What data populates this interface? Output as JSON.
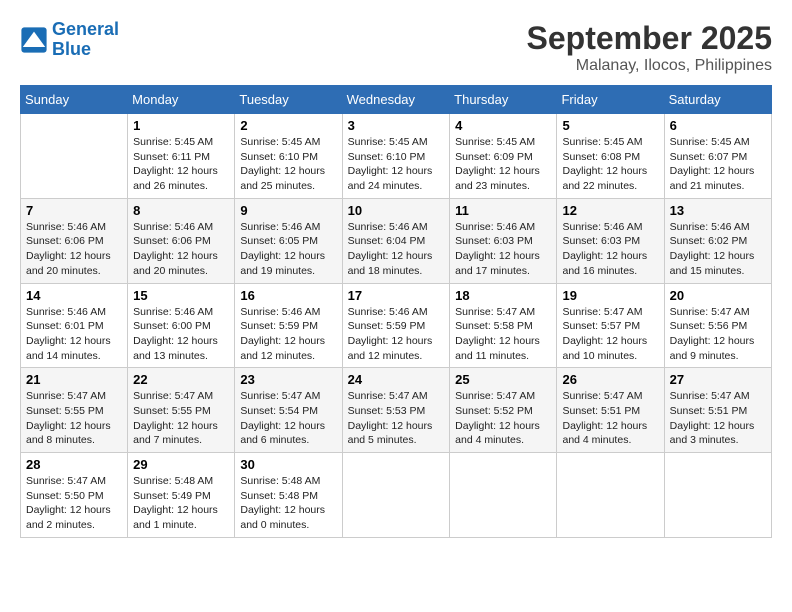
{
  "header": {
    "logo_text_general": "General",
    "logo_text_blue": "Blue",
    "month_year": "September 2025",
    "location": "Malanay, Ilocos, Philippines"
  },
  "columns": [
    "Sunday",
    "Monday",
    "Tuesday",
    "Wednesday",
    "Thursday",
    "Friday",
    "Saturday"
  ],
  "weeks": [
    [
      {
        "day": "",
        "info": ""
      },
      {
        "day": "1",
        "info": "Sunrise: 5:45 AM\nSunset: 6:11 PM\nDaylight: 12 hours\nand 26 minutes."
      },
      {
        "day": "2",
        "info": "Sunrise: 5:45 AM\nSunset: 6:10 PM\nDaylight: 12 hours\nand 25 minutes."
      },
      {
        "day": "3",
        "info": "Sunrise: 5:45 AM\nSunset: 6:10 PM\nDaylight: 12 hours\nand 24 minutes."
      },
      {
        "day": "4",
        "info": "Sunrise: 5:45 AM\nSunset: 6:09 PM\nDaylight: 12 hours\nand 23 minutes."
      },
      {
        "day": "5",
        "info": "Sunrise: 5:45 AM\nSunset: 6:08 PM\nDaylight: 12 hours\nand 22 minutes."
      },
      {
        "day": "6",
        "info": "Sunrise: 5:45 AM\nSunset: 6:07 PM\nDaylight: 12 hours\nand 21 minutes."
      }
    ],
    [
      {
        "day": "7",
        "info": "Sunrise: 5:46 AM\nSunset: 6:06 PM\nDaylight: 12 hours\nand 20 minutes."
      },
      {
        "day": "8",
        "info": "Sunrise: 5:46 AM\nSunset: 6:06 PM\nDaylight: 12 hours\nand 20 minutes."
      },
      {
        "day": "9",
        "info": "Sunrise: 5:46 AM\nSunset: 6:05 PM\nDaylight: 12 hours\nand 19 minutes."
      },
      {
        "day": "10",
        "info": "Sunrise: 5:46 AM\nSunset: 6:04 PM\nDaylight: 12 hours\nand 18 minutes."
      },
      {
        "day": "11",
        "info": "Sunrise: 5:46 AM\nSunset: 6:03 PM\nDaylight: 12 hours\nand 17 minutes."
      },
      {
        "day": "12",
        "info": "Sunrise: 5:46 AM\nSunset: 6:03 PM\nDaylight: 12 hours\nand 16 minutes."
      },
      {
        "day": "13",
        "info": "Sunrise: 5:46 AM\nSunset: 6:02 PM\nDaylight: 12 hours\nand 15 minutes."
      }
    ],
    [
      {
        "day": "14",
        "info": "Sunrise: 5:46 AM\nSunset: 6:01 PM\nDaylight: 12 hours\nand 14 minutes."
      },
      {
        "day": "15",
        "info": "Sunrise: 5:46 AM\nSunset: 6:00 PM\nDaylight: 12 hours\nand 13 minutes."
      },
      {
        "day": "16",
        "info": "Sunrise: 5:46 AM\nSunset: 5:59 PM\nDaylight: 12 hours\nand 12 minutes."
      },
      {
        "day": "17",
        "info": "Sunrise: 5:46 AM\nSunset: 5:59 PM\nDaylight: 12 hours\nand 12 minutes."
      },
      {
        "day": "18",
        "info": "Sunrise: 5:47 AM\nSunset: 5:58 PM\nDaylight: 12 hours\nand 11 minutes."
      },
      {
        "day": "19",
        "info": "Sunrise: 5:47 AM\nSunset: 5:57 PM\nDaylight: 12 hours\nand 10 minutes."
      },
      {
        "day": "20",
        "info": "Sunrise: 5:47 AM\nSunset: 5:56 PM\nDaylight: 12 hours\nand 9 minutes."
      }
    ],
    [
      {
        "day": "21",
        "info": "Sunrise: 5:47 AM\nSunset: 5:55 PM\nDaylight: 12 hours\nand 8 minutes."
      },
      {
        "day": "22",
        "info": "Sunrise: 5:47 AM\nSunset: 5:55 PM\nDaylight: 12 hours\nand 7 minutes."
      },
      {
        "day": "23",
        "info": "Sunrise: 5:47 AM\nSunset: 5:54 PM\nDaylight: 12 hours\nand 6 minutes."
      },
      {
        "day": "24",
        "info": "Sunrise: 5:47 AM\nSunset: 5:53 PM\nDaylight: 12 hours\nand 5 minutes."
      },
      {
        "day": "25",
        "info": "Sunrise: 5:47 AM\nSunset: 5:52 PM\nDaylight: 12 hours\nand 4 minutes."
      },
      {
        "day": "26",
        "info": "Sunrise: 5:47 AM\nSunset: 5:51 PM\nDaylight: 12 hours\nand 4 minutes."
      },
      {
        "day": "27",
        "info": "Sunrise: 5:47 AM\nSunset: 5:51 PM\nDaylight: 12 hours\nand 3 minutes."
      }
    ],
    [
      {
        "day": "28",
        "info": "Sunrise: 5:47 AM\nSunset: 5:50 PM\nDaylight: 12 hours\nand 2 minutes."
      },
      {
        "day": "29",
        "info": "Sunrise: 5:48 AM\nSunset: 5:49 PM\nDaylight: 12 hours\nand 1 minute."
      },
      {
        "day": "30",
        "info": "Sunrise: 5:48 AM\nSunset: 5:48 PM\nDaylight: 12 hours\nand 0 minutes."
      },
      {
        "day": "",
        "info": ""
      },
      {
        "day": "",
        "info": ""
      },
      {
        "day": "",
        "info": ""
      },
      {
        "day": "",
        "info": ""
      }
    ]
  ]
}
